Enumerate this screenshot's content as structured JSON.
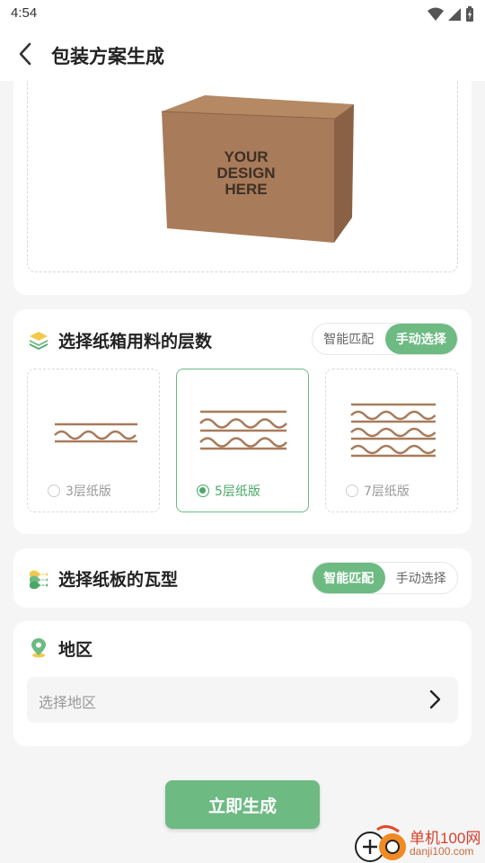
{
  "status_bar": {
    "time": "4:54"
  },
  "header": {
    "title": "包装方案生成"
  },
  "preview": {
    "box_text": [
      "YOUR",
      "DESIGN",
      "HERE"
    ]
  },
  "layers_section": {
    "title": "选择纸箱用料的层数",
    "toggle": {
      "smart": "智能匹配",
      "manual": "手动选择",
      "active": "manual"
    },
    "options": [
      {
        "label": "3层纸版",
        "selected": false
      },
      {
        "label": "5层纸版",
        "selected": true
      },
      {
        "label": "7层纸版",
        "selected": false
      }
    ]
  },
  "flute_section": {
    "title": "选择纸板的瓦型",
    "toggle": {
      "smart": "智能匹配",
      "manual": "手动选择",
      "active": "smart"
    }
  },
  "region_section": {
    "title": "地区",
    "placeholder": "选择地区"
  },
  "submit": {
    "label": "立即生成"
  },
  "watermark": {
    "name": "单机100网",
    "site": "danji100.com"
  },
  "colors": {
    "accent": "#6dba83",
    "accent_text": "#4aa866",
    "cardboard": "#a87b5a"
  }
}
